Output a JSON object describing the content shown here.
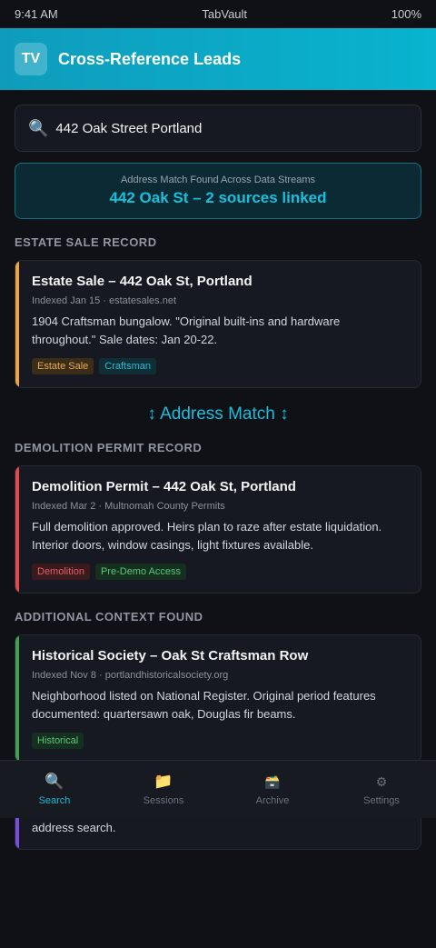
{
  "status": {
    "time": "9:41 AM",
    "app": "TabVault",
    "battery": "100%"
  },
  "header": {
    "logo": "TV",
    "title": "Cross-Reference Leads"
  },
  "search": {
    "icon": "magnifier-icon",
    "value": "442 Oak Street Portland"
  },
  "match": {
    "subtitle": "Address Match Found Across Data Streams",
    "title": "442 Oak St – 2 sources linked"
  },
  "sections": {
    "estate": "ESTATE SALE RECORD",
    "demolition": "DEMOLITION PERMIT RECORD",
    "context": "ADDITIONAL CONTEXT FOUND"
  },
  "estate_card": {
    "accent": "#f0a33c",
    "title": "Estate Sale – 442 Oak St, Portland",
    "meta": "Indexed Jan 15 · estatesales.net",
    "body": "1904 Craftsman bungalow. \"Original built-ins and hardware throughout.\" Sale dates: Jan 20-22.",
    "tags": [
      "Estate Sale",
      "Craftsman"
    ]
  },
  "address_match": "↕ Address Match ↕",
  "demolition_card": {
    "accent": "#e5484d",
    "title": "Demolition Permit – 442 Oak St, Portland",
    "meta": "Indexed Mar 2 · Multnomah County Permits",
    "body": "Full demolition approved. Heirs plan to raze after estate liquidation. Interior doors, window casings, light fixtures available.",
    "tags": [
      "Demolition",
      "Pre-Demo Access"
    ]
  },
  "historical_card": {
    "accent": "#3fa34d",
    "title": "Historical Society – Oak St Craftsman Row",
    "meta": "Indexed Nov 8 · portlandhistoricalsociety.org",
    "body": "Neighborhood listed on National Register. Original period features documented: quartersawn oak, Douglas fir beams.",
    "tags": [
      "Historical"
    ]
  },
  "overflow_card": {
    "accent": "#7a4de0",
    "body": "address search."
  },
  "nav": [
    {
      "label": "Search",
      "icon": "magnifier-icon",
      "glyph": "🔍",
      "active": true
    },
    {
      "label": "Sessions",
      "icon": "folder-icon",
      "glyph": "📁",
      "active": false
    },
    {
      "label": "Archive",
      "icon": "file-cabinet-icon",
      "glyph": "🗃️",
      "active": false
    },
    {
      "label": "Settings",
      "icon": "gear-icon",
      "glyph": "⚙",
      "active": false
    }
  ]
}
